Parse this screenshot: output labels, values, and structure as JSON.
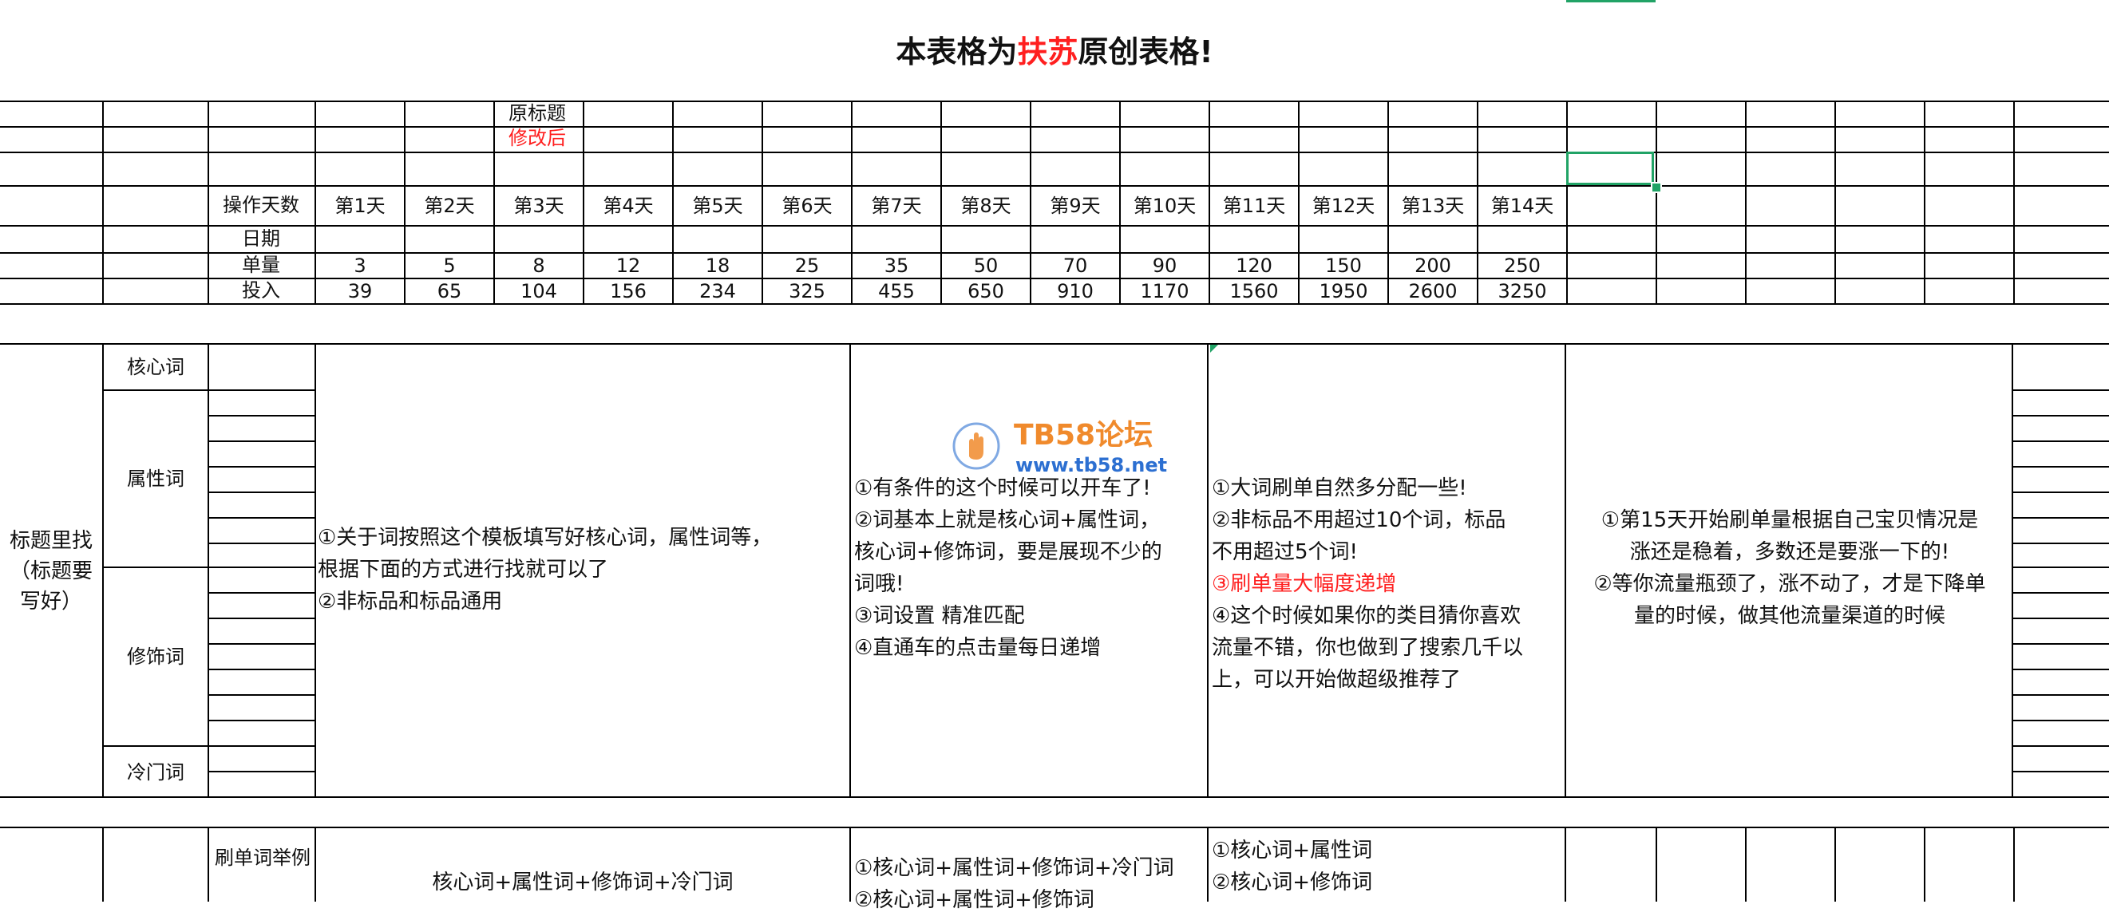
{
  "title": {
    "prefix": "本表格为",
    "highlight": "扶苏",
    "suffix": "原创表格!"
  },
  "header_labels": {
    "original_title": "原标题",
    "modified": "修改后"
  },
  "schedule": {
    "days_label": "操作天数",
    "date_label": "日期",
    "orders_label": "单量",
    "input_label": "投入",
    "days": [
      "第1天",
      "第2天",
      "第3天",
      "第4天",
      "第5天",
      "第6天",
      "第7天",
      "第8天",
      "第9天",
      "第10天",
      "第11天",
      "第12天",
      "第13天",
      "第14天"
    ],
    "orders": [
      "3",
      "5",
      "8",
      "12",
      "18",
      "25",
      "35",
      "50",
      "70",
      "90",
      "120",
      "150",
      "200",
      "250"
    ],
    "inputs": [
      "39",
      "65",
      "104",
      "156",
      "234",
      "325",
      "455",
      "650",
      "910",
      "1170",
      "1560",
      "1950",
      "2600",
      "3250"
    ]
  },
  "keywords_section": {
    "side_label": "标题里找\n（标题要\n写好）",
    "categories": [
      "核心词",
      "属性词",
      "修饰词",
      "冷门词"
    ]
  },
  "notes": {
    "col1": "①关于词按照这个模板填写好核心词，属性词等，\n根据下面的方式进行找就可以了\n②非标品和标品通用",
    "col2": "①有条件的这个时候可以开车了!\n②词基本上就是核心词+属性词，\n核心词+修饰词，要是展现不少的\n词哦!\n③词设置 精准匹配\n④直通车的点击量每日递增",
    "col3_a": "①大词刷单自然多分配一些!\n②非标品不用超过10个词，标品\n不用超过5个词!",
    "col3_red": "③刷单量大幅度递增",
    "col3_b": "④这个时候如果你的类目猜你喜欢\n流量不错，你也做到了搜索几千以\n上，可以开始做超级推荐了",
    "col4": "①第15天开始刷单量根据自己宝贝情况是\n涨还是稳着，多数还是要涨一下的!\n②等你流量瓶颈了，涨不动了，才是下降单\n量的时候，做其他流量渠道的时候"
  },
  "examples": {
    "label": "刷单词举例",
    "col1": "核心词+属性词+修饰词+冷门词",
    "col2_line1": "①核心词+属性词+修饰词+冷门词",
    "col2_line2": "②核心词+属性词+修饰词",
    "col3_line1": "①核心词+属性词",
    "col3_line2": "②核心词+修饰词"
  },
  "watermark": {
    "title": "TB58论坛",
    "url": "www.tb58.net"
  },
  "colors": {
    "grid": "#000000",
    "accent_red": "#ff1f1f",
    "selection": "#21a366",
    "watermark_orange": "#f08a2c",
    "watermark_blue": "#2c6fd1"
  }
}
